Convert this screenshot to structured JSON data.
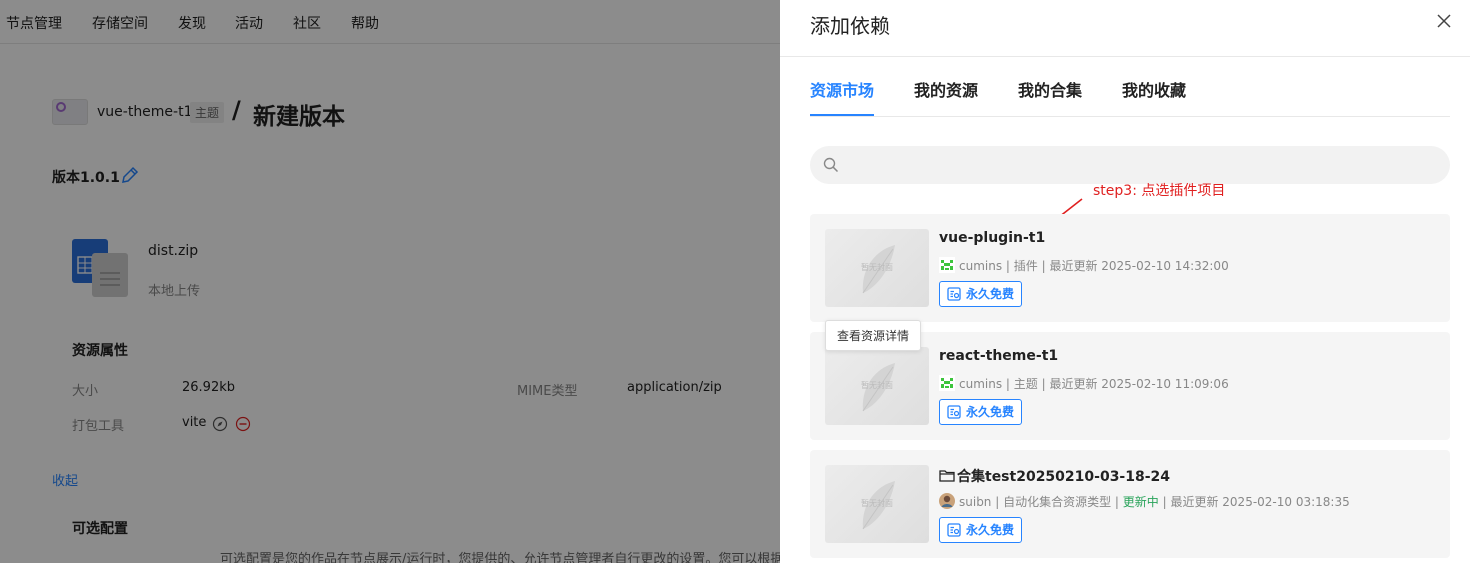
{
  "nav": {
    "items": [
      {
        "label": "节点管理"
      },
      {
        "label": "存储空间"
      },
      {
        "label": "发现"
      },
      {
        "label": "活动"
      },
      {
        "label": "社区"
      },
      {
        "label": "帮助"
      }
    ]
  },
  "breadcrumb": {
    "name": "vue-theme-t1",
    "tag": "主题",
    "separator": "/",
    "title": "新建版本"
  },
  "version": {
    "label": "版本1.0.1"
  },
  "file": {
    "name": "dist.zip",
    "source": "本地上传"
  },
  "props": {
    "title": "资源属性",
    "size_label": "大小",
    "size_value": "26.92kb",
    "mime_label": "MIME类型",
    "mime_value": "application/zip",
    "bundler_label": "打包工具",
    "bundler_value": "vite"
  },
  "collapse_label": "收起",
  "optional": {
    "title": "可选配置",
    "desc": "可选配置是您的作品在节点展示/运行时，您提供的、允许节点管理者自行更改的设置。您可以根据需要添"
  },
  "drawer": {
    "title": "添加依赖",
    "tabs": [
      {
        "label": "资源市场",
        "active": true
      },
      {
        "label": "我的资源",
        "active": false
      },
      {
        "label": "我的合集",
        "active": false
      },
      {
        "label": "我的收藏",
        "active": false
      }
    ],
    "search": {
      "value": "",
      "placeholder": ""
    },
    "annotation": "step3: 点选插件项目",
    "tooltip": "查看资源详情",
    "cover_text": "暂无封面",
    "results": [
      {
        "name": "vue-plugin-t1",
        "author": "cumins",
        "meta": " | 插件 | 最近更新 2025-02-10 14:32:00",
        "badge": "永久免费"
      },
      {
        "name": "react-theme-t1",
        "author": "cumins",
        "meta": " | 主题 | 最近更新 2025-02-10 11:09:06",
        "badge": "永久免费"
      },
      {
        "name": "合集test20250210-03-18-24",
        "author": "suibn",
        "meta_pre": " | 自动化集合资源类型 | ",
        "status": "更新中",
        "meta_post": " | 最近更新 2025-02-10 03:18:35",
        "badge": "永久免费"
      }
    ]
  },
  "colors": {
    "accent": "#2784ff",
    "annotation": "#e02020",
    "status_updating": "#29a35a"
  }
}
